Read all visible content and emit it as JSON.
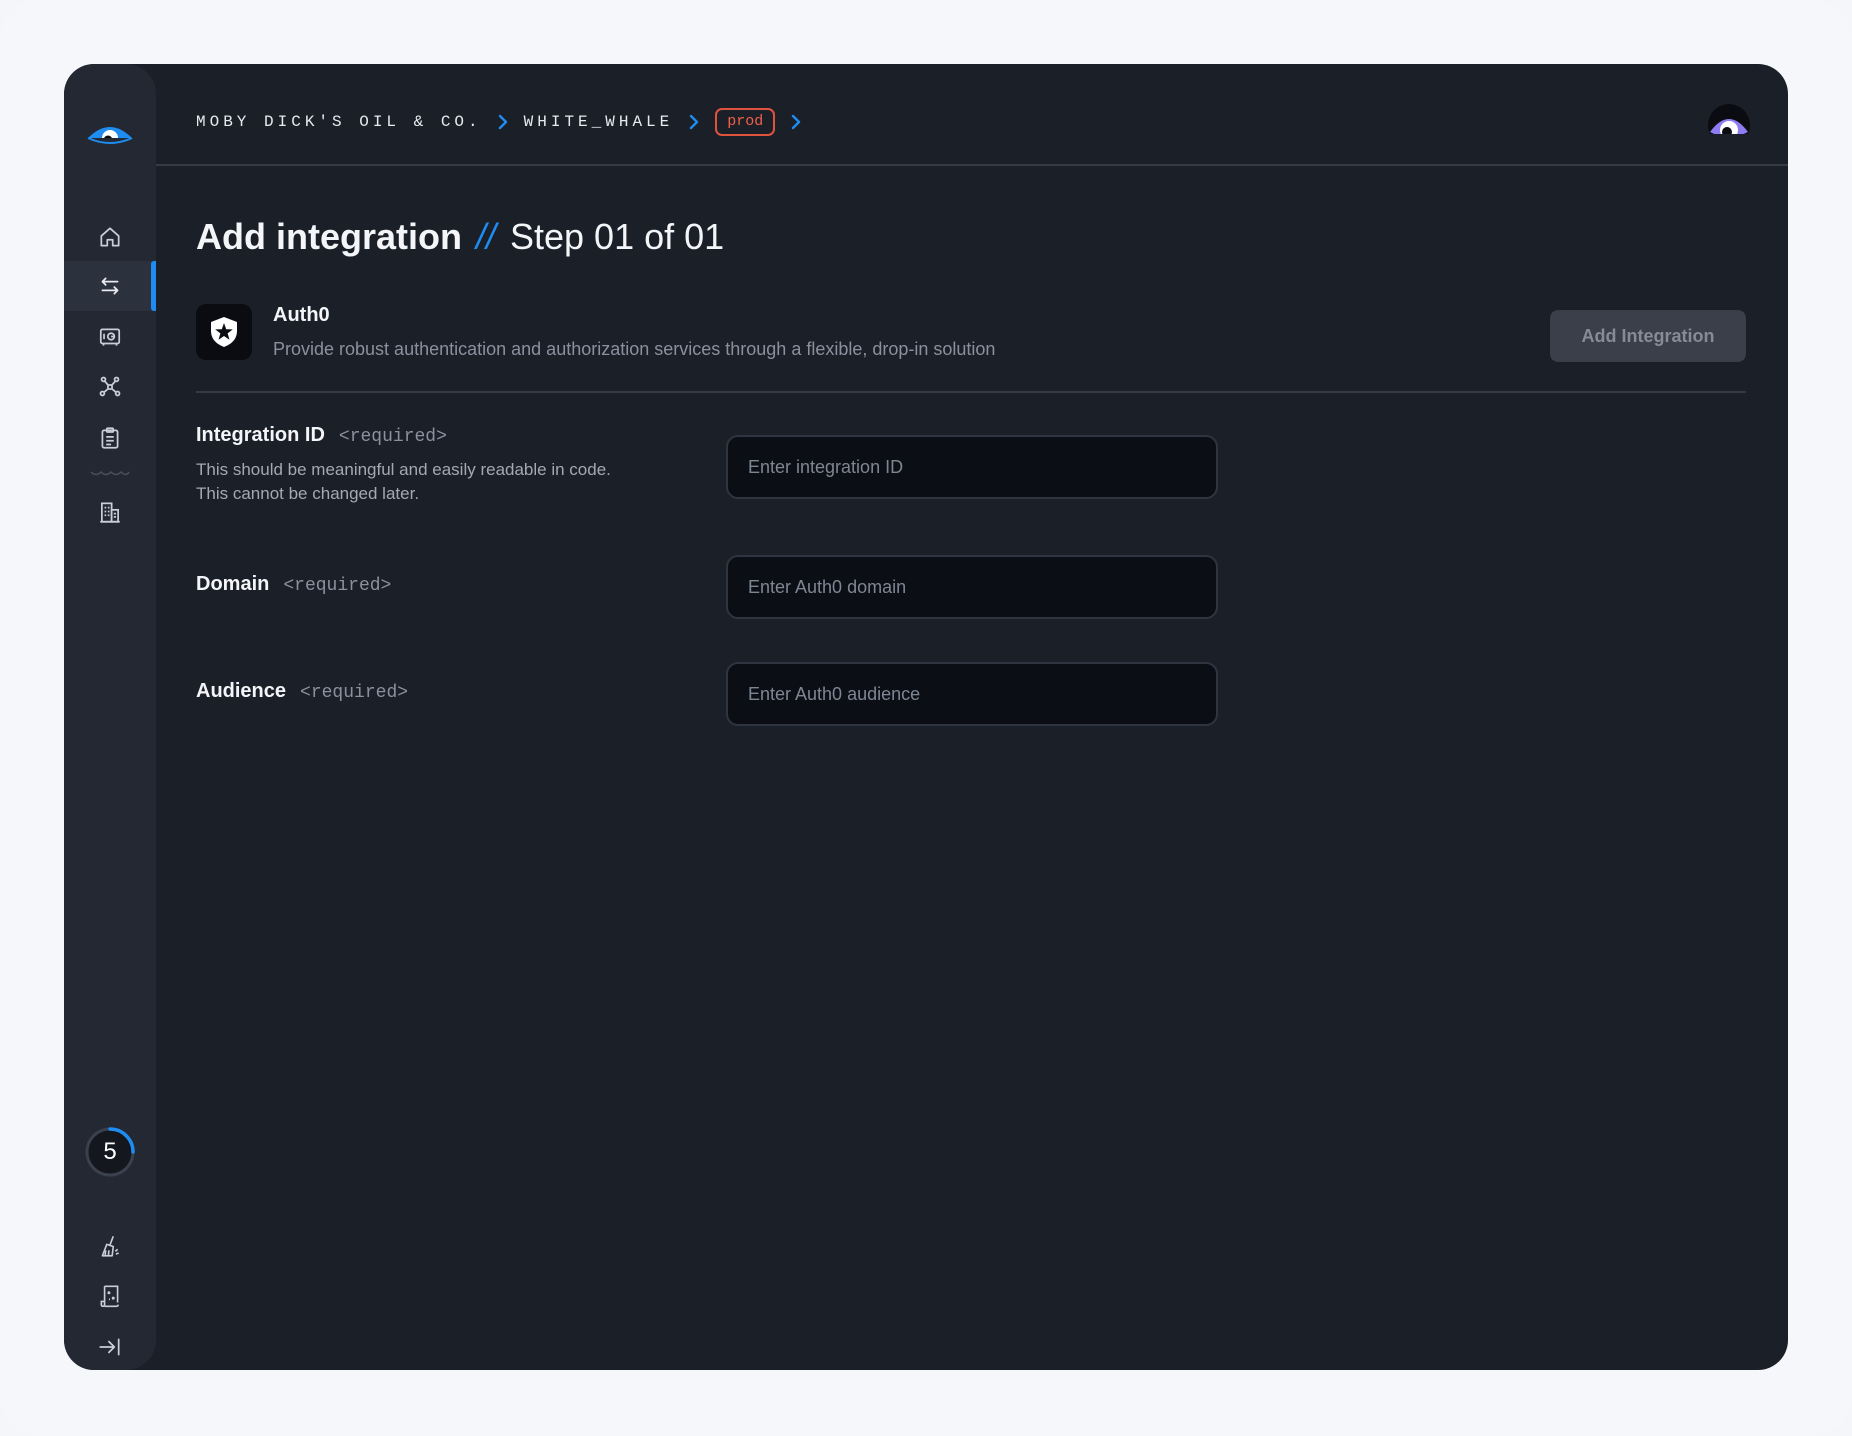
{
  "breadcrumb": {
    "org": "MOBY DICK'S OIL & CO.",
    "project": "WHITE_WHALE",
    "environment": "prod"
  },
  "page": {
    "title": "Add integration",
    "separator": "//",
    "step": "Step 01 of 01"
  },
  "integration": {
    "name": "Auth0",
    "description": "Provide robust authentication and authorization services through a flexible, drop-in solution",
    "add_button_label": "Add Integration"
  },
  "fields": {
    "integration_id": {
      "label": "Integration ID",
      "required": "<required>",
      "help_line1": "This should be meaningful and easily readable in code.",
      "help_line2": "This cannot be changed later.",
      "placeholder": "Enter integration ID",
      "value": ""
    },
    "domain": {
      "label": "Domain",
      "required": "<required>",
      "placeholder": "Enter Auth0 domain",
      "value": ""
    },
    "audience": {
      "label": "Audience",
      "required": "<required>",
      "placeholder": "Enter Auth0 audience",
      "value": ""
    }
  },
  "sidebar": {
    "items": [
      {
        "icon": "home-icon"
      },
      {
        "icon": "arrows-exchange-icon",
        "active": true
      },
      {
        "icon": "vault-icon"
      },
      {
        "icon": "network-icon"
      },
      {
        "icon": "clipboard-icon"
      },
      {
        "icon": "building-icon"
      }
    ],
    "counter": "5",
    "counter_progress": 0.25,
    "bottom_items": [
      {
        "icon": "broom-icon"
      },
      {
        "icon": "scroll-icon"
      },
      {
        "icon": "collapse-sidebar-icon"
      }
    ]
  },
  "colors": {
    "accent": "#1e8cf0",
    "env_badge": "#e2533f",
    "background": "#1b1f27",
    "sidebar": "#232833"
  }
}
